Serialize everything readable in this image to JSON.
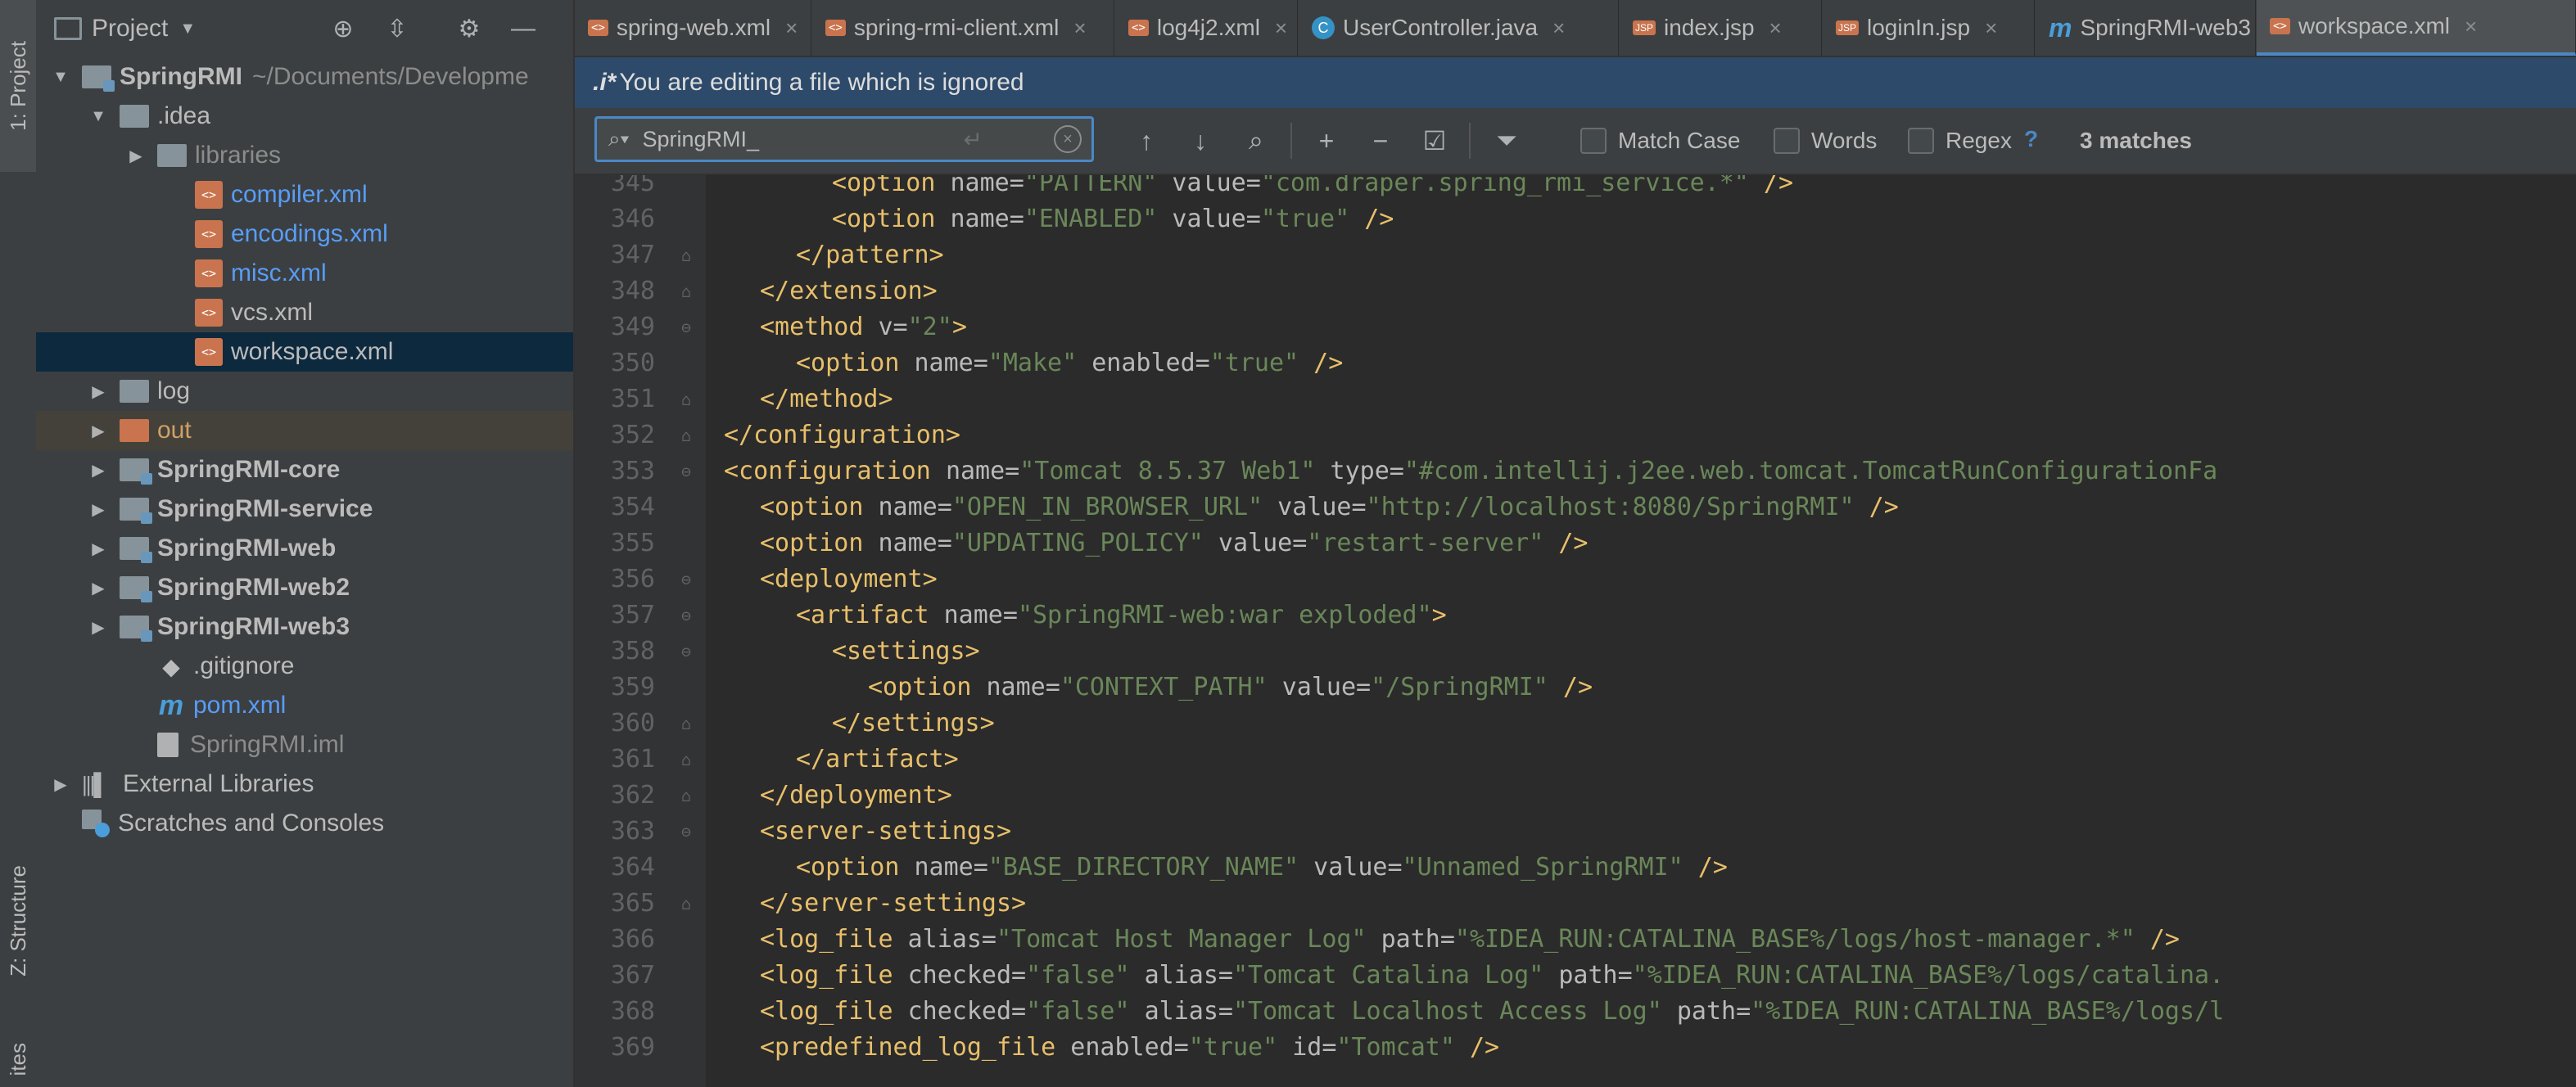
{
  "left_strip": {
    "project_tab": "1: Project",
    "structure_tab": "Z: Structure",
    "favorites_tab": "ites"
  },
  "project_panel": {
    "title": "Project",
    "tree": [
      {
        "label": "SpringRMI",
        "extra": "~/Documents/Developme",
        "depth": 0,
        "arrow": "down",
        "icon": "module-folder-icon",
        "style": "bold"
      },
      {
        "label": ".idea",
        "depth": 1,
        "arrow": "down",
        "icon": "folder-icon",
        "style": "normal"
      },
      {
        "label": "libraries",
        "depth": 2,
        "arrow": "right",
        "icon": "folder-icon",
        "style": "grey"
      },
      {
        "label": "compiler.xml",
        "depth": 3,
        "arrow": "",
        "icon": "xml-icon",
        "style": "blue"
      },
      {
        "label": "encodings.xml",
        "depth": 3,
        "arrow": "",
        "icon": "xml-icon",
        "style": "blue"
      },
      {
        "label": "misc.xml",
        "depth": 3,
        "arrow": "",
        "icon": "xml-icon",
        "style": "blue"
      },
      {
        "label": "vcs.xml",
        "depth": 3,
        "arrow": "",
        "icon": "xml-icon",
        "style": "normal"
      },
      {
        "label": "workspace.xml",
        "depth": 3,
        "arrow": "",
        "icon": "xml-icon",
        "style": "normal",
        "selected": true
      },
      {
        "label": "log",
        "depth": 1,
        "arrow": "right",
        "icon": "folder-icon",
        "style": "normal"
      },
      {
        "label": "out",
        "depth": 1,
        "arrow": "right",
        "icon": "excluded-folder-icon",
        "style": "orange",
        "excluded": true
      },
      {
        "label": "SpringRMI-core",
        "depth": 1,
        "arrow": "right",
        "icon": "module-folder-icon",
        "style": "bold"
      },
      {
        "label": "SpringRMI-service",
        "depth": 1,
        "arrow": "right",
        "icon": "module-folder-icon",
        "style": "bold"
      },
      {
        "label": "SpringRMI-web",
        "depth": 1,
        "arrow": "right",
        "icon": "module-folder-icon",
        "style": "bold"
      },
      {
        "label": "SpringRMI-web2",
        "depth": 1,
        "arrow": "right",
        "icon": "module-folder-icon",
        "style": "bold"
      },
      {
        "label": "SpringRMI-web3",
        "depth": 1,
        "arrow": "right",
        "icon": "module-folder-icon",
        "style": "bold"
      },
      {
        "label": ".gitignore",
        "depth": 2,
        "arrow": "",
        "icon": "git-icon",
        "style": "normal"
      },
      {
        "label": "pom.xml",
        "depth": 2,
        "arrow": "",
        "icon": "maven-icon",
        "style": "blue"
      },
      {
        "label": "SpringRMI.iml",
        "depth": 2,
        "arrow": "",
        "icon": "iml-file-icon",
        "style": "grey"
      },
      {
        "label": "External Libraries",
        "depth": 0,
        "arrow": "right",
        "icon": "libraries-icon",
        "style": "normal"
      },
      {
        "label": "Scratches and Consoles",
        "depth": 0,
        "arrow": "",
        "icon": "scratches-icon",
        "style": "normal"
      }
    ]
  },
  "tabs": [
    {
      "label": "spring-web.xml",
      "icon": "xml-file-icon",
      "badge": "<>",
      "active": false
    },
    {
      "label": "spring-rmi-client.xml",
      "icon": "xml-file-icon",
      "badge": "<>",
      "active": false
    },
    {
      "label": "log4j2.xml",
      "icon": "xml-file-icon",
      "badge": "<>",
      "active": false
    },
    {
      "label": "UserController.java",
      "icon": "java-class-icon",
      "badge": "C",
      "active": false
    },
    {
      "label": "index.jsp",
      "icon": "jsp-file-icon",
      "badge": "JSP",
      "active": false
    },
    {
      "label": "loginIn.jsp",
      "icon": "jsp-file-icon",
      "badge": "JSP",
      "active": false
    },
    {
      "label": "SpringRMI-web3",
      "icon": "maven-icon",
      "badge": "m",
      "active": false
    },
    {
      "label": "workspace.xml",
      "icon": "xml-file-icon",
      "badge": "<>",
      "active": true
    }
  ],
  "notice": {
    "icon_text": ".i*",
    "text": "You are editing a file which is ignored"
  },
  "search": {
    "value": "SpringRMI_",
    "match_case": "Match Case",
    "words": "Words",
    "regex": "Regex",
    "help": "?",
    "matches": "3 matches"
  },
  "code_lines": [
    {
      "n": "345",
      "fold": "",
      "indent": 6,
      "parts": [
        [
          "tag",
          "<option "
        ],
        [
          "attr",
          "name="
        ],
        [
          "val",
          "\"PATTERN\""
        ],
        [
          "attr",
          " value="
        ],
        [
          "val",
          "\"com.draper.spring_rmi_service.*\""
        ],
        [
          "tag",
          " />"
        ]
      ]
    },
    {
      "n": "346",
      "fold": "",
      "indent": 6,
      "parts": [
        [
          "tag",
          "<option "
        ],
        [
          "attr",
          "name="
        ],
        [
          "val",
          "\"ENABLED\""
        ],
        [
          "attr",
          " value="
        ],
        [
          "val",
          "\"true\""
        ],
        [
          "tag",
          " />"
        ]
      ]
    },
    {
      "n": "347",
      "fold": "⌂",
      "indent": 5,
      "parts": [
        [
          "tag",
          "</pattern>"
        ]
      ]
    },
    {
      "n": "348",
      "fold": "⌂",
      "indent": 4,
      "parts": [
        [
          "tag",
          "</extension>"
        ]
      ]
    },
    {
      "n": "349",
      "fold": "⊖",
      "indent": 4,
      "parts": [
        [
          "tag",
          "<method "
        ],
        [
          "attr",
          "v="
        ],
        [
          "val",
          "\"2\""
        ],
        [
          "tag",
          ">"
        ]
      ]
    },
    {
      "n": "350",
      "fold": "",
      "indent": 5,
      "parts": [
        [
          "tag",
          "<option "
        ],
        [
          "attr",
          "name="
        ],
        [
          "val",
          "\"Make\""
        ],
        [
          "attr",
          " enabled="
        ],
        [
          "val",
          "\"true\""
        ],
        [
          "tag",
          " />"
        ]
      ]
    },
    {
      "n": "351",
      "fold": "⌂",
      "indent": 4,
      "parts": [
        [
          "tag",
          "</method>"
        ]
      ]
    },
    {
      "n": "352",
      "fold": "⌂",
      "indent": 3,
      "parts": [
        [
          "tag",
          "</configuration>"
        ]
      ]
    },
    {
      "n": "353",
      "fold": "⊖",
      "indent": 3,
      "parts": [
        [
          "tag",
          "<configuration "
        ],
        [
          "attr",
          "name="
        ],
        [
          "val",
          "\"Tomcat 8.5.37 Web1\""
        ],
        [
          "attr",
          " type="
        ],
        [
          "val",
          "\"#com.intellij.j2ee.web.tomcat.TomcatRunConfigurationFa"
        ]
      ]
    },
    {
      "n": "354",
      "fold": "",
      "indent": 4,
      "parts": [
        [
          "tag",
          "<option "
        ],
        [
          "attr",
          "name="
        ],
        [
          "val",
          "\"OPEN_IN_BROWSER_URL\""
        ],
        [
          "attr",
          " value="
        ],
        [
          "val",
          "\"http://localhost:8080/SpringRMI\""
        ],
        [
          "tag",
          " />"
        ]
      ]
    },
    {
      "n": "355",
      "fold": "",
      "indent": 4,
      "parts": [
        [
          "tag",
          "<option "
        ],
        [
          "attr",
          "name="
        ],
        [
          "val",
          "\"UPDATING_POLICY\""
        ],
        [
          "attr",
          " value="
        ],
        [
          "val",
          "\"restart-server\""
        ],
        [
          "tag",
          " />"
        ]
      ]
    },
    {
      "n": "356",
      "fold": "⊖",
      "indent": 4,
      "parts": [
        [
          "tag",
          "<deployment>"
        ]
      ]
    },
    {
      "n": "357",
      "fold": "⊖",
      "indent": 5,
      "parts": [
        [
          "tag",
          "<artifact "
        ],
        [
          "attr",
          "name="
        ],
        [
          "val",
          "\"SpringRMI-web:war exploded\""
        ],
        [
          "tag",
          ">"
        ]
      ]
    },
    {
      "n": "358",
      "fold": "⊖",
      "indent": 6,
      "parts": [
        [
          "tag",
          "<settings>"
        ]
      ]
    },
    {
      "n": "359",
      "fold": "",
      "indent": 7,
      "parts": [
        [
          "tag",
          "<option "
        ],
        [
          "attr",
          "name="
        ],
        [
          "val",
          "\"CONTEXT_PATH\""
        ],
        [
          "attr",
          " value="
        ],
        [
          "val",
          "\"/SpringRMI\""
        ],
        [
          "tag",
          " />"
        ]
      ]
    },
    {
      "n": "360",
      "fold": "⌂",
      "indent": 6,
      "parts": [
        [
          "tag",
          "</settings>"
        ]
      ]
    },
    {
      "n": "361",
      "fold": "⌂",
      "indent": 5,
      "parts": [
        [
          "tag",
          "</artifact>"
        ]
      ]
    },
    {
      "n": "362",
      "fold": "⌂",
      "indent": 4,
      "parts": [
        [
          "tag",
          "</deployment>"
        ]
      ]
    },
    {
      "n": "363",
      "fold": "⊖",
      "indent": 4,
      "parts": [
        [
          "tag",
          "<server-settings>"
        ]
      ]
    },
    {
      "n": "364",
      "fold": "",
      "indent": 5,
      "parts": [
        [
          "tag",
          "<option "
        ],
        [
          "attr",
          "name="
        ],
        [
          "val",
          "\"BASE_DIRECTORY_NAME\""
        ],
        [
          "attr",
          " value="
        ],
        [
          "val",
          "\"Unnamed_SpringRMI\""
        ],
        [
          "tag",
          " />"
        ]
      ]
    },
    {
      "n": "365",
      "fold": "⌂",
      "indent": 4,
      "parts": [
        [
          "tag",
          "</server-settings>"
        ]
      ]
    },
    {
      "n": "366",
      "fold": "",
      "indent": 4,
      "parts": [
        [
          "tag",
          "<log_file "
        ],
        [
          "attr",
          "alias="
        ],
        [
          "val",
          "\"Tomcat Host Manager Log\""
        ],
        [
          "attr",
          " path="
        ],
        [
          "val",
          "\"%IDEA_RUN:CATALINA_BASE%/logs/host-manager.*\""
        ],
        [
          "tag",
          " />"
        ]
      ]
    },
    {
      "n": "367",
      "fold": "",
      "indent": 4,
      "parts": [
        [
          "tag",
          "<log_file "
        ],
        [
          "attr",
          "checked="
        ],
        [
          "val",
          "\"false\""
        ],
        [
          "attr",
          " alias="
        ],
        [
          "val",
          "\"Tomcat Catalina Log\""
        ],
        [
          "attr",
          " path="
        ],
        [
          "val",
          "\"%IDEA_RUN:CATALINA_BASE%/logs/catalina."
        ]
      ]
    },
    {
      "n": "368",
      "fold": "",
      "indent": 4,
      "parts": [
        [
          "tag",
          "<log_file "
        ],
        [
          "attr",
          "checked="
        ],
        [
          "val",
          "\"false\""
        ],
        [
          "attr",
          " alias="
        ],
        [
          "val",
          "\"Tomcat Localhost Access Log\""
        ],
        [
          "attr",
          " path="
        ],
        [
          "val",
          "\"%IDEA_RUN:CATALINA_BASE%/logs/l"
        ]
      ]
    },
    {
      "n": "369",
      "fold": "",
      "indent": 4,
      "parts": [
        [
          "tag",
          "<predefined_log_file "
        ],
        [
          "attr",
          "enabled="
        ],
        [
          "val",
          "\"true\""
        ],
        [
          "attr",
          " id="
        ],
        [
          "val",
          "\"Tomcat\""
        ],
        [
          "tag",
          " />"
        ]
      ]
    }
  ]
}
